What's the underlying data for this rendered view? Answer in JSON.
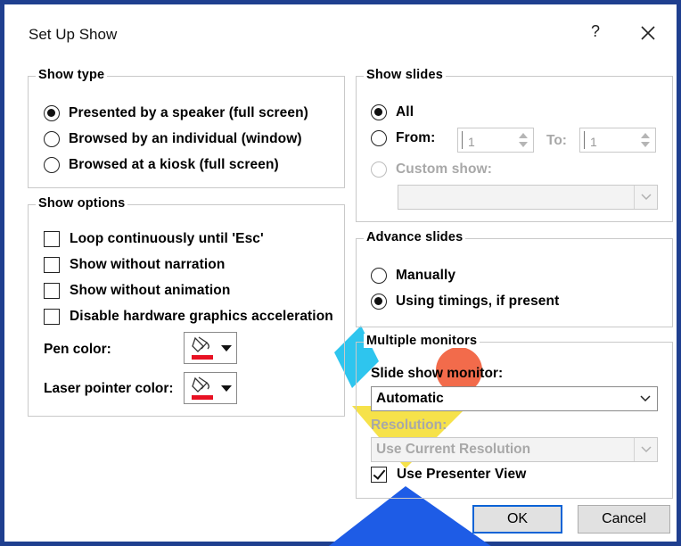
{
  "window": {
    "title": "Set Up Show",
    "help_label": "?"
  },
  "show_type": {
    "legend": "Show type",
    "options": [
      {
        "label": "Presented by a speaker (full screen)",
        "selected": true
      },
      {
        "label": "Browsed by an individual (window)",
        "selected": false
      },
      {
        "label": "Browsed at a kiosk (full screen)",
        "selected": false
      }
    ]
  },
  "show_options": {
    "legend": "Show options",
    "checkboxes": [
      {
        "label": "Loop continuously until 'Esc'",
        "checked": false
      },
      {
        "label": "Show without narration",
        "checked": false
      },
      {
        "label": "Show without animation",
        "checked": false
      },
      {
        "label": "Disable hardware graphics acceleration",
        "checked": false
      }
    ],
    "pen_color_label": "Pen color:",
    "laser_color_label": "Laser pointer color:",
    "pen_color": "#e81123",
    "laser_color": "#e81123"
  },
  "show_slides": {
    "legend": "Show slides",
    "all_label": "All",
    "from_label": "From:",
    "from_value": "1",
    "to_label": "To:",
    "to_value": "1",
    "custom_label": "Custom show:",
    "custom_value": ""
  },
  "advance_slides": {
    "legend": "Advance slides",
    "manual_label": "Manually",
    "timings_label": "Using timings, if present"
  },
  "monitors": {
    "legend": "Multiple monitors",
    "monitor_label": "Slide show monitor:",
    "monitor_value": "Automatic",
    "resolution_label": "Resolution:",
    "resolution_value": "Use Current Resolution",
    "presenter_view_label": "Use Presenter View",
    "presenter_view_checked": true
  },
  "buttons": {
    "ok": "OK",
    "cancel": "Cancel"
  },
  "colors": {
    "accent": "#0b63d6",
    "window_border": "#1f3f8f"
  }
}
